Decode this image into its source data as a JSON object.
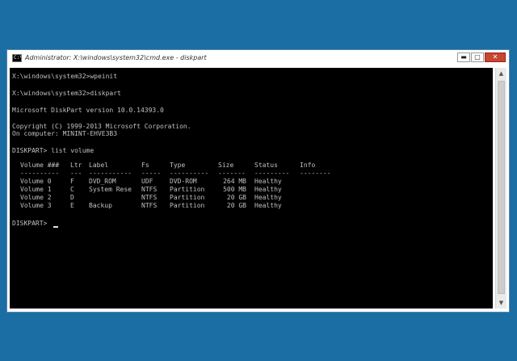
{
  "window": {
    "title": "Administrator: X:\\windows\\system32\\cmd.exe - diskpart",
    "icon_text": "C:\\",
    "controls": {
      "minimize": "▬",
      "maximize": "▢",
      "close": "✕"
    }
  },
  "console": {
    "lines": [
      "X:\\windows\\system32>wpeinit",
      "X:\\windows\\system32>diskpart",
      "Microsoft DiskPart version 10.0.14393.0",
      "Copyright (C) 1999-2013 Microsoft Corporation.",
      "On computer: MININT-EHVE3B3",
      "DISKPART> list volume",
      "DISKPART> "
    ],
    "table": {
      "headers": [
        "Volume ###",
        "Ltr",
        "Label",
        "Fs",
        "Type",
        "Size",
        "Status",
        "Info"
      ],
      "separators": [
        "----------",
        "---",
        "-----------",
        "-----",
        "----------",
        "-------",
        "---------",
        "--------"
      ],
      "rows": [
        [
          "Volume 0",
          "F",
          "DVD_ROM",
          "UDF",
          "DVD-ROM",
          "264 MB",
          "Healthy",
          ""
        ],
        [
          "Volume 1",
          "C",
          "System Rese",
          "NTFS",
          "Partition",
          "500 MB",
          "Healthy",
          ""
        ],
        [
          "Volume 2",
          "D",
          "",
          "NTFS",
          "Partition",
          "20 GB",
          "Healthy",
          ""
        ],
        [
          "Volume 3",
          "E",
          "Backup",
          "NTFS",
          "Partition",
          "20 GB",
          "Healthy",
          ""
        ]
      ]
    }
  },
  "colors": {
    "desktop": "#1a6ea3",
    "console_bg": "#000000",
    "console_text": "#c0c0c0",
    "close_button": "#c8452f"
  },
  "icons": [
    "cmd-icon",
    "minimize-icon",
    "maximize-icon",
    "close-icon",
    "scroll-up-arrow-icon",
    "scroll-down-arrow-icon"
  ]
}
